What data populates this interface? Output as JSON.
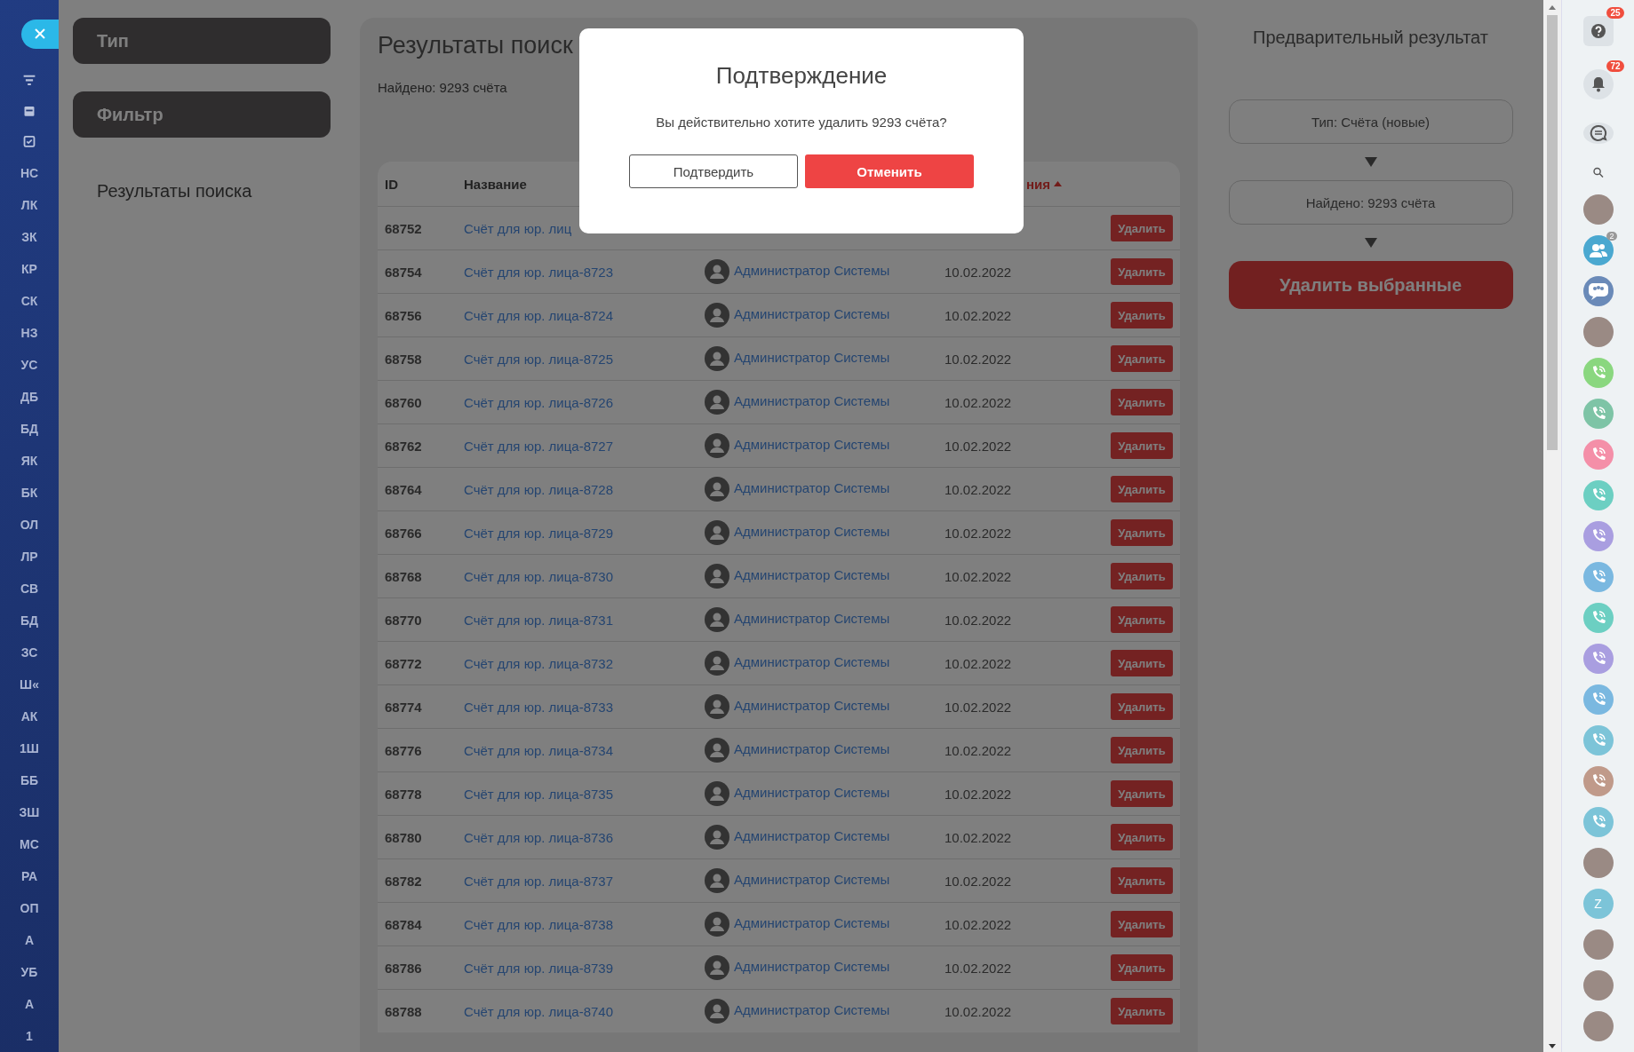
{
  "sidebar": {
    "labels": [
      "НС",
      "ЛК",
      "ЗК",
      "КР",
      "СК",
      "НЗ",
      "УС",
      "ДБ",
      "БД",
      "ЯК",
      "БК",
      "ОЛ",
      "ЛР",
      "СВ",
      "БД",
      "ЗС",
      "Ш«",
      "АК",
      "1Ш",
      "ББ",
      "ЗШ",
      "МС",
      "РА",
      "ОП",
      "А",
      "УБ",
      "А",
      "1"
    ]
  },
  "left_panel": {
    "buttons": [
      "Тип",
      "Фильтр"
    ],
    "tab": {
      "label": "Результаты поиска"
    }
  },
  "results": {
    "title": "Результаты поиск",
    "found": "Найдено: 9293 счёта",
    "table": {
      "columns": [
        "ID",
        "Название",
        "ния"
      ],
      "rows": [
        {
          "id": "68752",
          "name": "Счёт для юр. лиц",
          "delete": "Удалить"
        },
        {
          "id": "68754",
          "name": "Счёт для юр. лица-8723",
          "author": "Администратор Системы",
          "date": "10.02.2022",
          "delete": "Удалить"
        },
        {
          "id": "68756",
          "name": "Счёт для юр. лица-8724",
          "author": "Администратор Системы",
          "date": "10.02.2022",
          "delete": "Удалить"
        },
        {
          "id": "68758",
          "name": "Счёт для юр. лица-8725",
          "author": "Администратор Системы",
          "date": "10.02.2022",
          "delete": "Удалить"
        },
        {
          "id": "68760",
          "name": "Счёт для юр. лица-8726",
          "author": "Администратор Системы",
          "date": "10.02.2022",
          "delete": "Удалить"
        },
        {
          "id": "68762",
          "name": "Счёт для юр. лица-8727",
          "author": "Администратор Системы",
          "date": "10.02.2022",
          "delete": "Удалить"
        },
        {
          "id": "68764",
          "name": "Счёт для юр. лица-8728",
          "author": "Администратор Системы",
          "date": "10.02.2022",
          "delete": "Удалить"
        },
        {
          "id": "68766",
          "name": "Счёт для юр. лица-8729",
          "author": "Администратор Системы",
          "date": "10.02.2022",
          "delete": "Удалить"
        },
        {
          "id": "68768",
          "name": "Счёт для юр. лица-8730",
          "author": "Администратор Системы",
          "date": "10.02.2022",
          "delete": "Удалить"
        },
        {
          "id": "68770",
          "name": "Счёт для юр. лица-8731",
          "author": "Администратор Системы",
          "date": "10.02.2022",
          "delete": "Удалить"
        },
        {
          "id": "68772",
          "name": "Счёт для юр. лица-8732",
          "author": "Администратор Системы",
          "date": "10.02.2022",
          "delete": "Удалить"
        },
        {
          "id": "68774",
          "name": "Счёт для юр. лица-8733",
          "author": "Администратор Системы",
          "date": "10.02.2022",
          "delete": "Удалить"
        },
        {
          "id": "68776",
          "name": "Счёт для юр. лица-8734",
          "author": "Администратор Системы",
          "date": "10.02.2022",
          "delete": "Удалить"
        },
        {
          "id": "68778",
          "name": "Счёт для юр. лица-8735",
          "author": "Администратор Системы",
          "date": "10.02.2022",
          "delete": "Удалить"
        },
        {
          "id": "68780",
          "name": "Счёт для юр. лица-8736",
          "author": "Администратор Системы",
          "date": "10.02.2022",
          "delete": "Удалить"
        },
        {
          "id": "68782",
          "name": "Счёт для юр. лица-8737",
          "author": "Администратор Системы",
          "date": "10.02.2022",
          "delete": "Удалить"
        },
        {
          "id": "68784",
          "name": "Счёт для юр. лица-8738",
          "author": "Администратор Системы",
          "date": "10.02.2022",
          "delete": "Удалить"
        },
        {
          "id": "68786",
          "name": "Счёт для юр. лица-8739",
          "author": "Администратор Системы",
          "date": "10.02.2022",
          "delete": "Удалить"
        },
        {
          "id": "68788",
          "name": "Счёт для юр. лица-8740",
          "author": "Администратор Системы",
          "date": "10.02.2022",
          "delete": "Удалить"
        }
      ]
    }
  },
  "preview": {
    "title": "Предварительный результат",
    "steps": [
      "Тип: Счёта (новые)",
      "Найдено: 9293 счёта"
    ],
    "action": "Удалить выбранные"
  },
  "toolbar": {
    "help_badge": "25",
    "bell_badge": "72"
  },
  "contacts": [
    {
      "kind": "photo"
    },
    {
      "kind": "group",
      "badge": "2"
    },
    {
      "kind": "group_chat"
    },
    {
      "kind": "photo"
    },
    {
      "kind": "phone",
      "color": "#8ad77f"
    },
    {
      "kind": "phone",
      "color": "#7ec4a6"
    },
    {
      "kind": "phone",
      "color": "#f48fa8"
    },
    {
      "kind": "phone",
      "color": "#6ccfc2"
    },
    {
      "kind": "phone",
      "color": "#a99ee0"
    },
    {
      "kind": "phone",
      "color": "#7ab8e0"
    },
    {
      "kind": "phone",
      "color": "#6ccfc2"
    },
    {
      "kind": "phone",
      "color": "#a99ee0"
    },
    {
      "kind": "phone",
      "color": "#7ab8e0"
    },
    {
      "kind": "phone",
      "color": "#7cc4d8"
    },
    {
      "kind": "phone",
      "color": "#c09a8a"
    },
    {
      "kind": "phone",
      "color": "#7cc4d8"
    },
    {
      "kind": "photo"
    },
    {
      "kind": "letter",
      "letter": "Z",
      "color": "#7cc4d8"
    },
    {
      "kind": "photo"
    },
    {
      "kind": "photo"
    },
    {
      "kind": "photo"
    }
  ],
  "modal": {
    "title": "Подтверждение",
    "message": "Вы действительно хотите удалить 9293 счёта?",
    "confirm": "Подтвердить",
    "cancel": "Отменить"
  }
}
